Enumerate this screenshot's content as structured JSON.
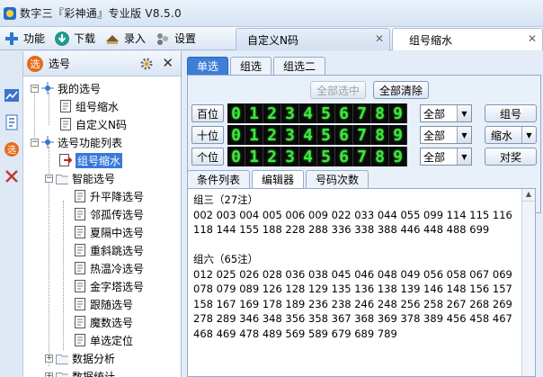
{
  "window": {
    "title": "数字三『彩神通』专业版    V8.5.0"
  },
  "menu": [
    {
      "label": "功能",
      "icon": "plus-icon"
    },
    {
      "label": "下载",
      "icon": "download-icon"
    },
    {
      "label": "录入",
      "icon": "input-icon"
    },
    {
      "label": "设置",
      "icon": "settings-icon"
    }
  ],
  "doc_tabs": [
    {
      "label": "自定义N码",
      "active": false
    },
    {
      "label": "组号缩水",
      "active": true
    }
  ],
  "left_panel": {
    "title": "选号",
    "tree": [
      {
        "label": "我的选号",
        "level": 0,
        "expander": "-"
      },
      {
        "label": "组号缩水",
        "level": 1
      },
      {
        "label": "自定义N码",
        "level": 1
      },
      {
        "label": "选号功能列表",
        "level": 0,
        "expander": "-"
      },
      {
        "label": "组号缩水",
        "level": 1,
        "selected": true
      },
      {
        "label": "智能选号",
        "level": 1,
        "expander": "-"
      },
      {
        "label": "升平降选号",
        "level": 2
      },
      {
        "label": "邻孤传选号",
        "level": 2
      },
      {
        "label": "夏隔中选号",
        "level": 2
      },
      {
        "label": "重斜跳选号",
        "level": 2
      },
      {
        "label": "热温冷选号",
        "level": 2
      },
      {
        "label": "金字塔选号",
        "level": 2
      },
      {
        "label": "跟随选号",
        "level": 2
      },
      {
        "label": "魔数选号",
        "level": 2
      },
      {
        "label": "单选定位",
        "level": 2
      },
      {
        "label": "数据分析",
        "level": 1,
        "expander": "+"
      },
      {
        "label": "数据统计",
        "level": 1,
        "expander": "+"
      }
    ]
  },
  "selector": {
    "tabs": [
      "单选",
      "组选",
      "组选二"
    ],
    "active_tab": 0,
    "select_all_label": "全部选中",
    "clear_all_label": "全部清除",
    "rows": [
      {
        "label": "百位",
        "digits": [
          "0",
          "1",
          "2",
          "3",
          "4",
          "5",
          "6",
          "7",
          "8",
          "9"
        ],
        "filter": "全部"
      },
      {
        "label": "十位",
        "digits": [
          "0",
          "1",
          "2",
          "3",
          "4",
          "5",
          "6",
          "7",
          "8",
          "9"
        ],
        "filter": "全部"
      },
      {
        "label": "个位",
        "digits": [
          "0",
          "1",
          "2",
          "3",
          "4",
          "5",
          "6",
          "7",
          "8",
          "9"
        ],
        "filter": "全部"
      }
    ],
    "actions": {
      "group_label": "组号",
      "shrink_label": "缩水",
      "check_label": "对奖"
    }
  },
  "lower_tabs": [
    "条件列表",
    "编辑器",
    "号码次数"
  ],
  "lower_active": 1,
  "editor": {
    "lines": [
      "组三（27注）",
      "002 003 004 005 006 009 022 033 044 055 099 114 115 116",
      "118 144 155 188 228 288 336 338 388 446 448 488 699",
      "",
      "组六（65注）",
      "012 025 026 028 036 038 045 046 048 049 056 058 067 069",
      "078 079 089 126 128 129 135 136 138 139 146 148 156 157",
      "158 167 169 178 189 236 238 246 248 256 258 267 268 269",
      "278 289 346 348 356 358 367 368 369 378 389 456 458 467",
      "468 469 478 489 569 589 679 689 789"
    ]
  },
  "colors": {
    "accent": "#3d7fd6",
    "digit_fg": "#3ee63e",
    "digit_bg": "#0a0a0a",
    "selected_bg": "#3879d9"
  }
}
